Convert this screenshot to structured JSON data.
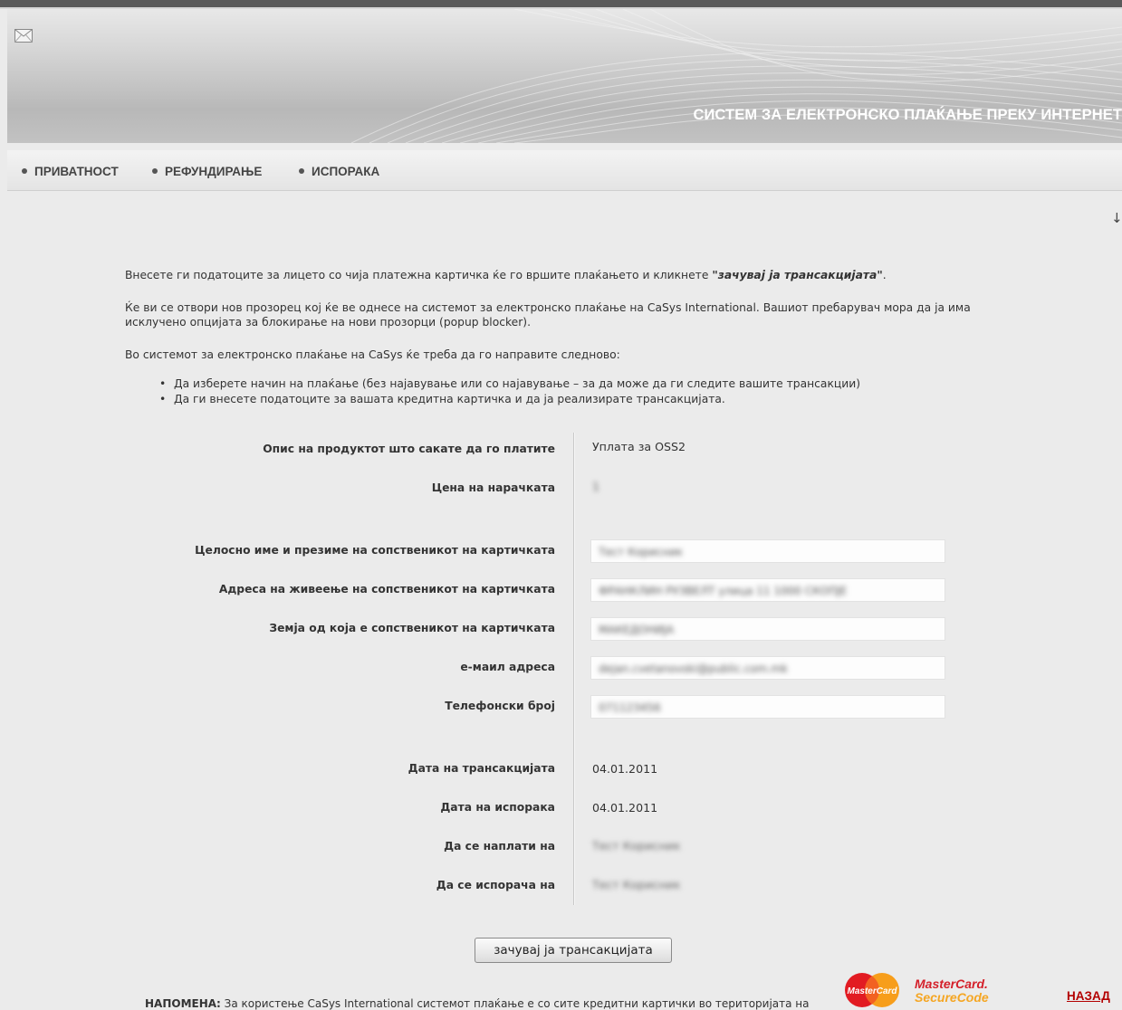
{
  "header": {
    "title": "СИСТЕМ ЗА ЕЛЕКТРОНСКО ПЛАЌАЊЕ ПРЕКУ ИНТЕРНЕТ",
    "mail_icon": "mail-icon"
  },
  "nav": {
    "items": [
      {
        "label": "ПРИВАТНОСТ"
      },
      {
        "label": "РЕФУНДИРАЊЕ"
      },
      {
        "label": "ИСПОРАКА"
      }
    ]
  },
  "scroll_icon": "↓",
  "intro": {
    "p1_text": "Внесете ги податоците за лицето со чија платежна картичка ќе го вршите плаќањето и кликнете ",
    "p1_emphasis": "\"зачувај ја трансакцијата\"",
    "p1_end": ".",
    "p2_line1": "Ќе ви се отвори нов прозорец кој ќе ве однесе на системот за електронско плаќање на CaSys International. Вашиот пребарувач мора да ја има",
    "p2_line2": "исклучено опцијата за блокирање на нови прозорци (popup blocker).",
    "p3": "Во системот за електронско плаќање на CaSys ќе треба да го направите следново:",
    "steps": [
      "Да изберете начин на плаќање (без најавување или со најавување – за да може да ги следите вашите трансакции)",
      "Да ги внесете податоците за вашата кредитна картичка и да ја реализирате трансакцијата."
    ]
  },
  "form": {
    "product_label": "Опис на продуктот што сакате да го платите",
    "product_value": "Уплата за OSS2",
    "price_label": "Цена на нарачката",
    "price_value": "1",
    "name_label": "Целосно име и презиме на сопственикот на картичката",
    "name_value": "Тест Корисник",
    "address_label": "Адреса на живеење на сопственикот на картичката",
    "address_value": "ФРАНКЛИН РУЗВЕЛТ улица 11 1000 СКОПЈЕ",
    "country_label": "Земја од која е сопственикот на картичката",
    "country_value": "МАКЕДОНИЈА",
    "email_label": "е-маил адреса",
    "email_value": "dejan.cvetanovski@public.com.mk",
    "phone_label": "Телефонски број",
    "phone_value": "071123456",
    "trans_date_label": "Дата на трансакцијата",
    "trans_date_value": "04.01.2011",
    "delivery_date_label": "Дата на испорака",
    "delivery_date_value": "04.01.2011",
    "bill_to_label": "Да се наплати на",
    "bill_to_value": "Тест Корисник",
    "ship_to_label": "Да се испорача на",
    "ship_to_value": "Тест Корисник",
    "submit_label": "зачувај ја трансакцијата"
  },
  "footer": {
    "note_prefix": "НАПОМЕНА:",
    "note_text": " За користење CaSys International системот плаќање е со сите кредитни картички во територијата на",
    "mastercard_label": "MasterCard",
    "mastercard_secure_1": "MasterCard.",
    "mastercard_secure_2": "SecureCode",
    "back_label": "НАЗАД"
  }
}
